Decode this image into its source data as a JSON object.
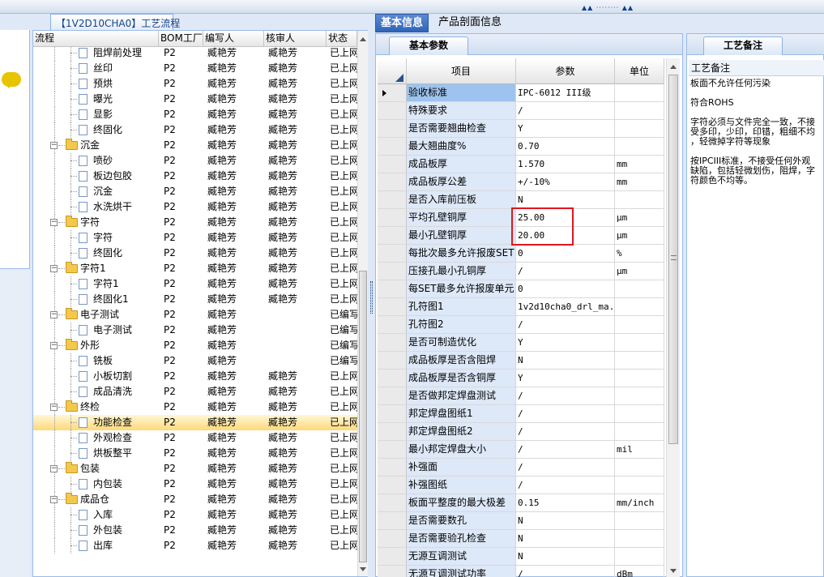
{
  "process_panel": {
    "tab_title": "【1V2D10CHA0】工艺流程",
    "columns": [
      "流程",
      "BOM工厂",
      "编写人",
      "核审人",
      "状态"
    ],
    "rows": [
      {
        "name": "阻焊前处理",
        "level": 2,
        "bom": "P2",
        "writer": "臧艳芳",
        "reviewer": "臧艳芳",
        "status": "已上网"
      },
      {
        "name": "丝印",
        "level": 2,
        "bom": "P2",
        "writer": "臧艳芳",
        "reviewer": "臧艳芳",
        "status": "已上网"
      },
      {
        "name": "预烘",
        "level": 2,
        "bom": "P2",
        "writer": "臧艳芳",
        "reviewer": "臧艳芳",
        "status": "已上网"
      },
      {
        "name": "曝光",
        "level": 2,
        "bom": "P2",
        "writer": "臧艳芳",
        "reviewer": "臧艳芳",
        "status": "已上网"
      },
      {
        "name": "显影",
        "level": 2,
        "bom": "P2",
        "writer": "臧艳芳",
        "reviewer": "臧艳芳",
        "status": "已上网"
      },
      {
        "name": "终固化",
        "level": 2,
        "bom": "P2",
        "writer": "臧艳芳",
        "reviewer": "臧艳芳",
        "status": "已上网"
      },
      {
        "name": "沉金",
        "level": 1,
        "bom": "P2",
        "writer": "臧艳芳",
        "reviewer": "臧艳芳",
        "status": "已上网"
      },
      {
        "name": "喷砂",
        "level": 2,
        "bom": "P2",
        "writer": "臧艳芳",
        "reviewer": "臧艳芳",
        "status": "已上网"
      },
      {
        "name": "板边包胶",
        "level": 2,
        "bom": "P2",
        "writer": "臧艳芳",
        "reviewer": "臧艳芳",
        "status": "已上网"
      },
      {
        "name": "沉金",
        "level": 2,
        "bom": "P2",
        "writer": "臧艳芳",
        "reviewer": "臧艳芳",
        "status": "已上网"
      },
      {
        "name": "水洗烘干",
        "level": 2,
        "bom": "P2",
        "writer": "臧艳芳",
        "reviewer": "臧艳芳",
        "status": "已上网"
      },
      {
        "name": "字符",
        "level": 1,
        "bom": "P2",
        "writer": "臧艳芳",
        "reviewer": "臧艳芳",
        "status": "已上网"
      },
      {
        "name": "字符",
        "level": 2,
        "bom": "P2",
        "writer": "臧艳芳",
        "reviewer": "臧艳芳",
        "status": "已上网"
      },
      {
        "name": "终固化",
        "level": 2,
        "bom": "P2",
        "writer": "臧艳芳",
        "reviewer": "臧艳芳",
        "status": "已上网"
      },
      {
        "name": "字符1",
        "level": 1,
        "bom": "P2",
        "writer": "臧艳芳",
        "reviewer": "臧艳芳",
        "status": "已上网"
      },
      {
        "name": "字符1",
        "level": 2,
        "bom": "P2",
        "writer": "臧艳芳",
        "reviewer": "臧艳芳",
        "status": "已上网"
      },
      {
        "name": "终固化1",
        "level": 2,
        "bom": "P2",
        "writer": "臧艳芳",
        "reviewer": "臧艳芳",
        "status": "已上网"
      },
      {
        "name": "电子测试",
        "level": 1,
        "bom": "P2",
        "writer": "臧艳芳",
        "reviewer": "",
        "status": "已编写"
      },
      {
        "name": "电子测试",
        "level": 2,
        "bom": "P2",
        "writer": "臧艳芳",
        "reviewer": "",
        "status": "已编写"
      },
      {
        "name": "外形",
        "level": 1,
        "bom": "P2",
        "writer": "臧艳芳",
        "reviewer": "",
        "status": "已编写"
      },
      {
        "name": "铣板",
        "level": 2,
        "bom": "P2",
        "writer": "臧艳芳",
        "reviewer": "",
        "status": "已编写"
      },
      {
        "name": "小板切割",
        "level": 2,
        "bom": "P2",
        "writer": "臧艳芳",
        "reviewer": "臧艳芳",
        "status": "已上网"
      },
      {
        "name": "成品清洗",
        "level": 2,
        "bom": "P2",
        "writer": "臧艳芳",
        "reviewer": "臧艳芳",
        "status": "已上网"
      },
      {
        "name": "终检",
        "level": 1,
        "bom": "P2",
        "writer": "臧艳芳",
        "reviewer": "臧艳芳",
        "status": "已上网"
      },
      {
        "name": "功能检查",
        "level": 2,
        "bom": "P2",
        "writer": "臧艳芳",
        "reviewer": "臧艳芳",
        "status": "已上网",
        "selected": true
      },
      {
        "name": "外观检查",
        "level": 2,
        "bom": "P2",
        "writer": "臧艳芳",
        "reviewer": "臧艳芳",
        "status": "已上网"
      },
      {
        "name": "烘板整平",
        "level": 2,
        "bom": "P2",
        "writer": "臧艳芳",
        "reviewer": "臧艳芳",
        "status": "已上网"
      },
      {
        "name": "包装",
        "level": 1,
        "bom": "P2",
        "writer": "臧艳芳",
        "reviewer": "臧艳芳",
        "status": "已上网"
      },
      {
        "name": "内包装",
        "level": 2,
        "bom": "P2",
        "writer": "臧艳芳",
        "reviewer": "臧艳芳",
        "status": "已上网"
      },
      {
        "name": "成品仓",
        "level": 1,
        "bom": "P2",
        "writer": "臧艳芳",
        "reviewer": "臧艳芳",
        "status": "已上网"
      },
      {
        "name": "入库",
        "level": 2,
        "bom": "P2",
        "writer": "臧艳芳",
        "reviewer": "臧艳芳",
        "status": "已上网"
      },
      {
        "name": "外包装",
        "level": 2,
        "bom": "P2",
        "writer": "臧艳芳",
        "reviewer": "臧艳芳",
        "status": "已上网"
      },
      {
        "name": "出库",
        "level": 2,
        "bom": "P2",
        "writer": "臧艳芳",
        "reviewer": "臧艳芳",
        "status": "已上网"
      }
    ]
  },
  "main_tabs": [
    {
      "label": "基本信息",
      "active": true
    },
    {
      "label": "产品剖面信息",
      "active": false
    }
  ],
  "params": {
    "tab_label": "基本参数",
    "columns": [
      "项目",
      "参数",
      "单位"
    ],
    "rows": [
      {
        "item": "验收标准",
        "value": "IPC-6012 III级",
        "unit": "",
        "current": true
      },
      {
        "item": "特殊要求",
        "value": "/",
        "unit": ""
      },
      {
        "item": "是否需要翘曲检查",
        "value": "Y",
        "unit": ""
      },
      {
        "item": "最大翘曲度%",
        "value": "0.70",
        "unit": ""
      },
      {
        "item": "成品板厚",
        "value": "1.570",
        "unit": "mm"
      },
      {
        "item": "成品板厚公差",
        "value": "+/-10%",
        "unit": "mm"
      },
      {
        "item": "是否入库前压板",
        "value": "N",
        "unit": ""
      },
      {
        "item": "平均孔壁铜厚",
        "value": "25.00",
        "unit": "μm"
      },
      {
        "item": "最小孔壁铜厚",
        "value": "20.00",
        "unit": "μm"
      },
      {
        "item": "每批次最多允许报废SET",
        "value": "0",
        "unit": "%"
      },
      {
        "item": "压接孔最小孔铜厚",
        "value": "/",
        "unit": "μm"
      },
      {
        "item": "每SET最多允许报废单元",
        "value": "0",
        "unit": ""
      },
      {
        "item": "孔符图1",
        "value": "1v2d10cha0_drl_ma...",
        "unit": ""
      },
      {
        "item": "孔符图2",
        "value": "/",
        "unit": ""
      },
      {
        "item": "是否可制造优化",
        "value": "Y",
        "unit": ""
      },
      {
        "item": "成品板厚是否含阻焊",
        "value": "N",
        "unit": ""
      },
      {
        "item": "成品板厚是否含铜厚",
        "value": "Y",
        "unit": ""
      },
      {
        "item": "是否做邦定焊盘测试",
        "value": "/",
        "unit": ""
      },
      {
        "item": "邦定焊盘图纸1",
        "value": "/",
        "unit": ""
      },
      {
        "item": "邦定焊盘图纸2",
        "value": "/",
        "unit": ""
      },
      {
        "item": "最小邦定焊盘大小",
        "value": "/",
        "unit": "mil"
      },
      {
        "item": "补强面",
        "value": "/",
        "unit": ""
      },
      {
        "item": "补强图纸",
        "value": "/",
        "unit": ""
      },
      {
        "item": "板面平整度的最大极差",
        "value": "0.15",
        "unit": "mm/inch"
      },
      {
        "item": "是否需要数孔",
        "value": "N",
        "unit": ""
      },
      {
        "item": "是否需要验孔检查",
        "value": "N",
        "unit": ""
      },
      {
        "item": "无源互调测试",
        "value": "N",
        "unit": ""
      },
      {
        "item": "无源互调测试功率",
        "value": "/",
        "unit": "dBm"
      }
    ]
  },
  "notes": {
    "tab_label": "工艺备注",
    "header": "工艺备注",
    "lines": [
      "板面不允许任何污染",
      "符合ROHS",
      "字符必须与文件完全一致，不接",
      "受多印，少印，印错，粗细不均",
      "，轻微掉字符等现象",
      "按IPCIII标准，不接受任何外观",
      "缺陷，包括轻微划伤，阻焊，字",
      "符颜色不均等。"
    ]
  }
}
